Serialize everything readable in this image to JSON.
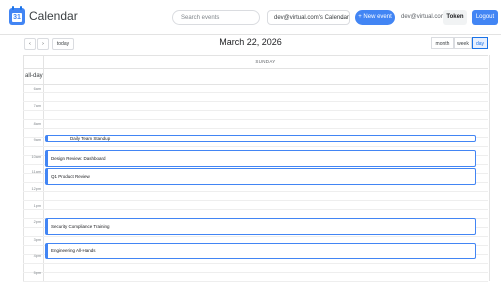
{
  "app": {
    "title": "Calendar",
    "logo_text": "31"
  },
  "header": {
    "search_placeholder": "Search events",
    "calendar_select": "dev@virtual.com's Calendar",
    "new_event_label": "+ New event",
    "user_email": "dev@virtual.com",
    "token_label": "Token",
    "logout_label": "Logout"
  },
  "toolbar": {
    "prev": "‹",
    "next": "›",
    "today": "today",
    "date_title": "March 22, 2026",
    "views": [
      "month",
      "week",
      "day"
    ],
    "active_view": "day"
  },
  "day_header": "SUNDAY",
  "allday_label": "all-day",
  "time_labels": [
    "6am",
    "7am",
    "8am",
    "9am",
    "10am",
    "11am",
    "12pm",
    "1pm",
    "2pm",
    "3pm",
    "4pm",
    "5pm"
  ],
  "events": [
    {
      "title": "Daily Team Standup"
    },
    {
      "title": "Design Review: Dashboard"
    },
    {
      "title": "Q1 Product Review"
    },
    {
      "title": "Security Compliance Training"
    },
    {
      "title": "Engineering All-Hands"
    }
  ],
  "colors": {
    "accent": "#4285f4",
    "event_border": "#4285f4"
  }
}
